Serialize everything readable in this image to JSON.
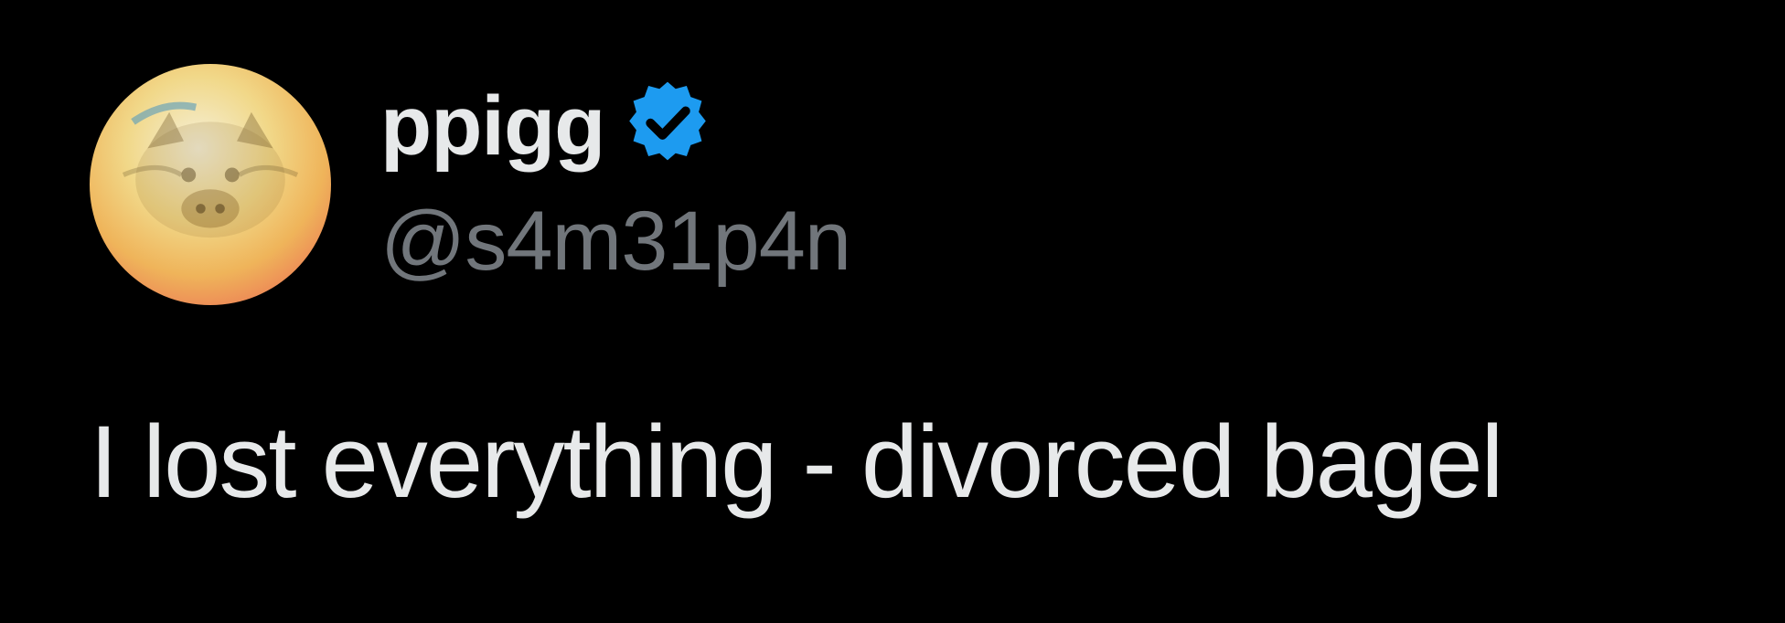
{
  "tweet": {
    "author": {
      "display_name": "ppigg",
      "handle": "@s4m31p4n",
      "verified": true,
      "verified_icon": "verified-badge-icon",
      "avatar_icon": "pig-avatar"
    },
    "text": "I lost everything - divorced bagel"
  },
  "colors": {
    "background": "#000000",
    "primary_text": "#e7e9ea",
    "secondary_text": "#71767b",
    "verified_blue": "#1d9bf0"
  }
}
